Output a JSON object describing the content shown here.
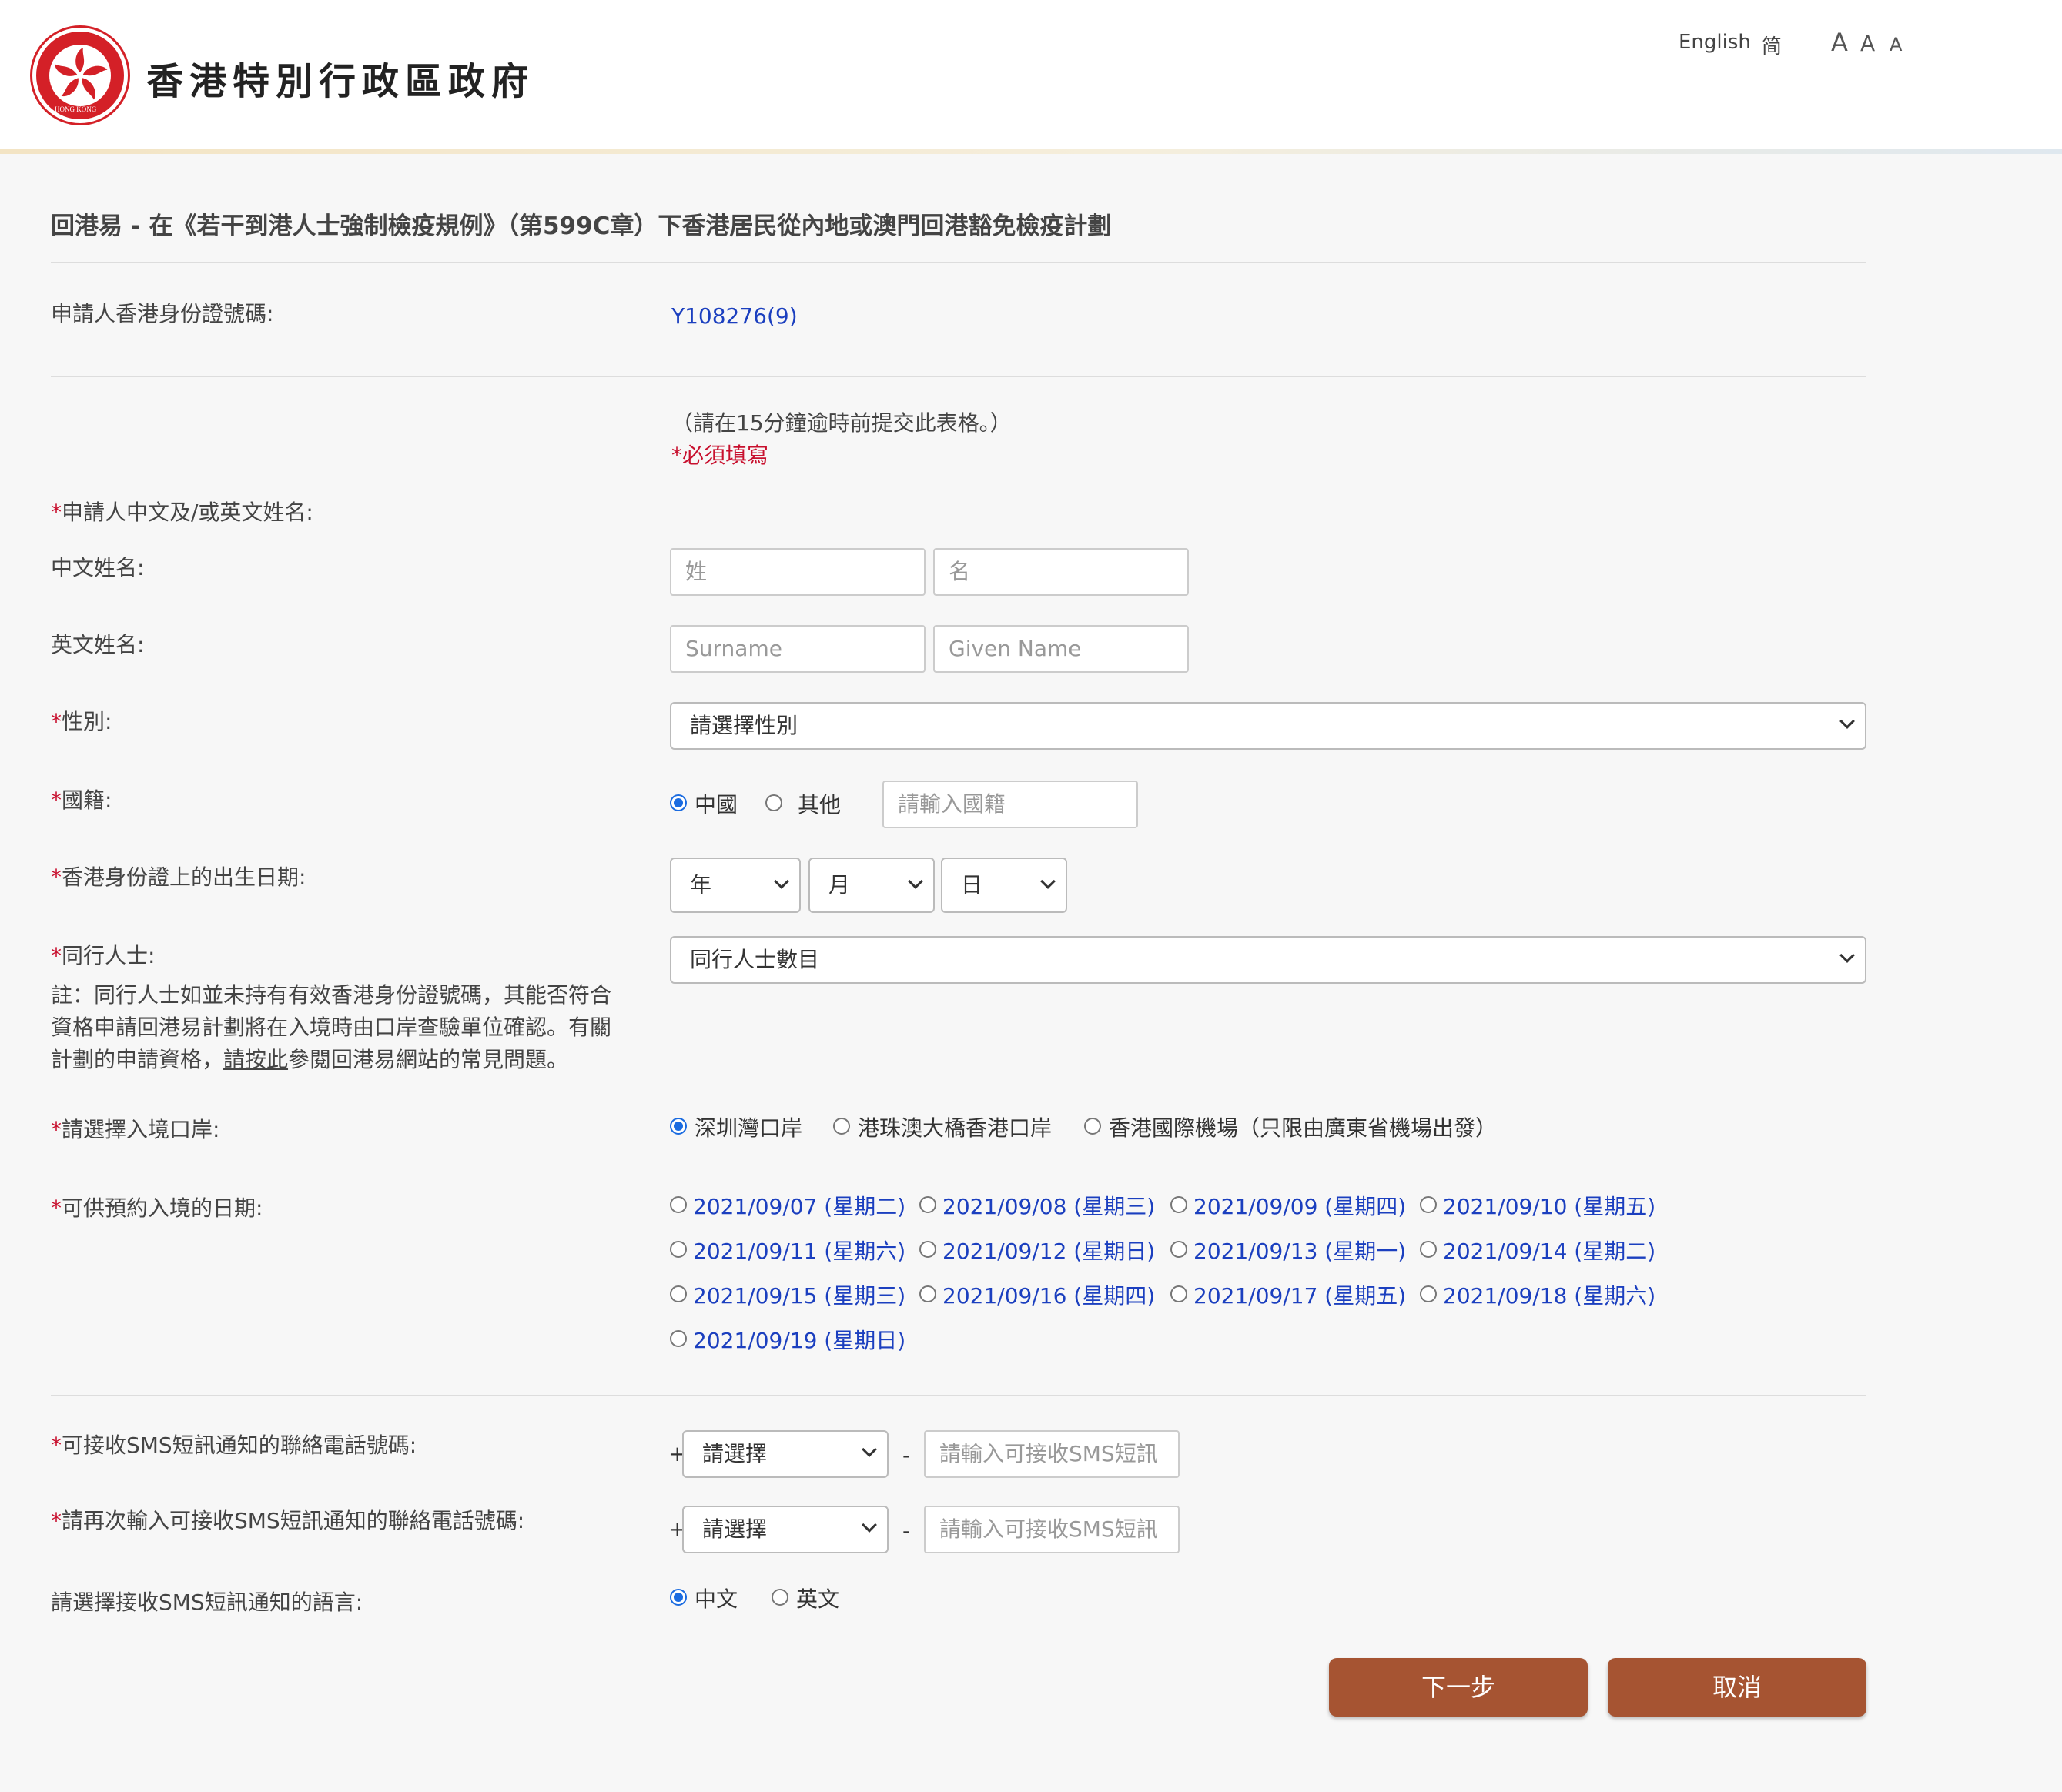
{
  "header": {
    "gov_title": "香港特別行政區政府",
    "emblem_text": "HONG KONG",
    "lang_english": "English",
    "lang_simplified": "简",
    "font_sizes": [
      "A",
      "A",
      "A"
    ]
  },
  "page_title": "回港易 - 在《若干到港人士強制檢疫規例》（第599C章）下香港居民從內地或澳門回港豁免檢疫計劃",
  "hkid": {
    "label": "申請人香港身份證號碼:",
    "value": "Y108276(9)"
  },
  "notice": {
    "time_limit": "（請在15分鐘逾時前提交此表格。）",
    "required_prefix": "*",
    "required_text": "必須填寫"
  },
  "required_mark": "*",
  "name": {
    "label": "申請人中文及/或英文姓名:",
    "chinese_label": "中文姓名:",
    "chinese_surname_placeholder": "姓",
    "chinese_given_placeholder": "名",
    "english_label": "英文姓名:",
    "english_surname_placeholder": "Surname",
    "english_given_placeholder": "Given Name"
  },
  "gender": {
    "label": "性別:",
    "selected": "請選擇性別"
  },
  "nationality": {
    "label": "國籍:",
    "options": [
      "中國",
      "其他"
    ],
    "selected_index": 0,
    "other_placeholder": "請輸入國籍"
  },
  "dob": {
    "label": "香港身份證上的出生日期:",
    "year": "年",
    "month": "月",
    "day": "日"
  },
  "companions": {
    "label": "同行人士:",
    "selected": "同行人士數目",
    "note_line1": "註：同行人士如並未持有有效香港身份證號碼，其能否符合",
    "note_line2": "資格申請回港易計劃將在入境時由口岸查驗單位確認。有關",
    "note_line3_pre": "計劃的申請資格，",
    "note_line3_link": "請按此",
    "note_line3_post": "參閱回港易網站的常見問題。"
  },
  "port": {
    "label": "請選擇入境口岸:",
    "options": [
      "深圳灣口岸",
      "港珠澳大橋香港口岸",
      "香港國際機場（只限由廣東省機場出發）"
    ],
    "selected_index": 0
  },
  "dates": {
    "label": "可供預約入境的日期:",
    "options": [
      "2021/09/07 (星期二)",
      "2021/09/08 (星期三)",
      "2021/09/09 (星期四)",
      "2021/09/10 (星期五)",
      "2021/09/11 (星期六)",
      "2021/09/12 (星期日)",
      "2021/09/13 (星期一)",
      "2021/09/14 (星期二)",
      "2021/09/15 (星期三)",
      "2021/09/16 (星期四)",
      "2021/09/17 (星期五)",
      "2021/09/18 (星期六)",
      "2021/09/19 (星期日)"
    ]
  },
  "phone": {
    "label": "可接收SMS短訊通知的聯絡電話號碼:",
    "confirm_label": "請再次輸入可接收SMS短訊通知的聯絡電話號碼:",
    "plus": "+",
    "dash": "-",
    "code_selected": "請選擇",
    "number_placeholder": "請輸入可接收SMS短訊"
  },
  "sms_language": {
    "label": "請選擇接收SMS短訊通知的語言:",
    "options": [
      "中文",
      "英文"
    ],
    "selected_index": 0
  },
  "buttons": {
    "next": "下一步",
    "cancel": "取消"
  },
  "colors": {
    "accent_button": "#a65432",
    "link_blue": "#1b3fbf",
    "required_red": "#c8102e",
    "radio_blue": "#1a6be0",
    "emblem_red": "#d42027"
  }
}
